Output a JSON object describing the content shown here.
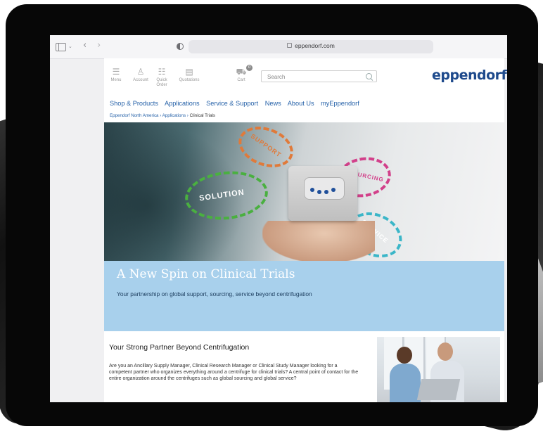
{
  "browser": {
    "url": "eppendorf.com"
  },
  "header": {
    "icons": [
      {
        "label": "Menu",
        "icon": "hamburger-icon"
      },
      {
        "label": "Account",
        "icon": "user-icon"
      },
      {
        "label": "Quick Order",
        "icon": "quick-order-icon"
      },
      {
        "label": "Quotations",
        "icon": "document-icon"
      },
      {
        "label": "Cart",
        "icon": "cart-icon"
      }
    ],
    "cart_count": "0",
    "search_placeholder": "Search",
    "logo": "eppendorf"
  },
  "nav": {
    "items": [
      "Shop & Products",
      "Applications",
      "Service & Support",
      "News",
      "About Us",
      "myEppendorf"
    ]
  },
  "breadcrumb": {
    "items": [
      "Eppendorf North America",
      "Applications"
    ],
    "current": "Clinical Trials"
  },
  "hero": {
    "rings": [
      "SUPPORT",
      "SOURCING",
      "SOLUTION",
      "SERVICE"
    ],
    "title": "A New Spin on Clinical Trials",
    "subtitle": "Your partnership on global support, sourcing, service beyond centrifugation"
  },
  "content": {
    "heading": "Your Strong Partner Beyond Centrifugation",
    "paragraph": "Are you an Ancillary Supply Manager, Clinical Research Manager or Clinical Study Manager looking for a competent partner who organizes everything around a centrifuge for clinical trials? A central point of contact for the entire organization around the centrifuges such as global sourcing and global service?"
  },
  "colors": {
    "brand": "#1e4a8c",
    "link": "#2561a8",
    "hero_panel": "#a8d0ec"
  }
}
